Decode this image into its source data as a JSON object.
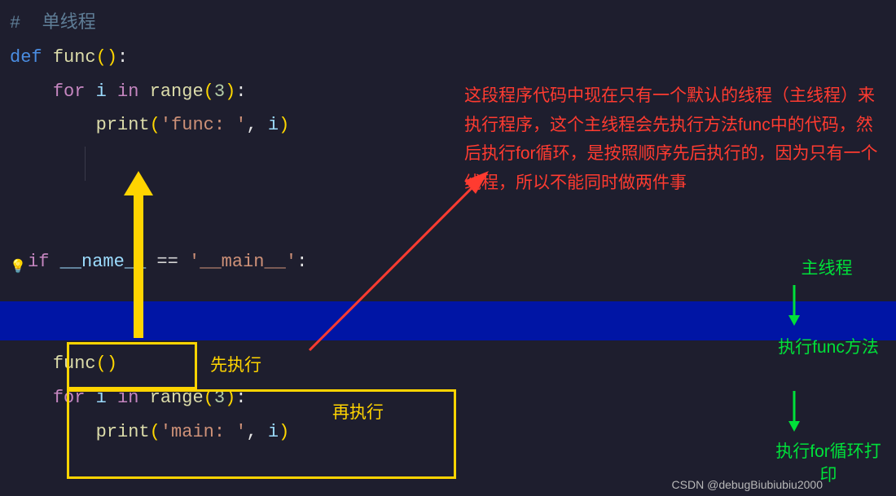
{
  "code": {
    "comment": "#  单线程",
    "def": "def",
    "funcName": "func",
    "lparen": "(",
    "rparen": ")",
    "colon": ":",
    "forKw": "for",
    "inKw": "in",
    "iVar": "i",
    "rangeKw": "range",
    "three": "3",
    "printKw": "print",
    "strFunc": "'func: '",
    "comma": ", ",
    "ifKw": "if",
    "nameVar": "__name__",
    "eq": " == ",
    "mainStr": "'__main__'",
    "funcCall": "func",
    "strMain": "'main: '"
  },
  "annotations": {
    "red_explain": "这段程序代码中现在只有一个默认的线程（主线程）来执行程序，这个主线程会先执行方法func中的代码，然后执行for循环，是按照顺序先后执行的，因为只有一个线程，所以不能同时做两件事",
    "green_main_thread": "主线程",
    "green_exec_func": "执行func方法",
    "green_exec_for": "执行for循环打印",
    "yellow_first": "先执行",
    "yellow_second": "再执行"
  },
  "watermark": "CSDN @debugBiubiubiu2000"
}
